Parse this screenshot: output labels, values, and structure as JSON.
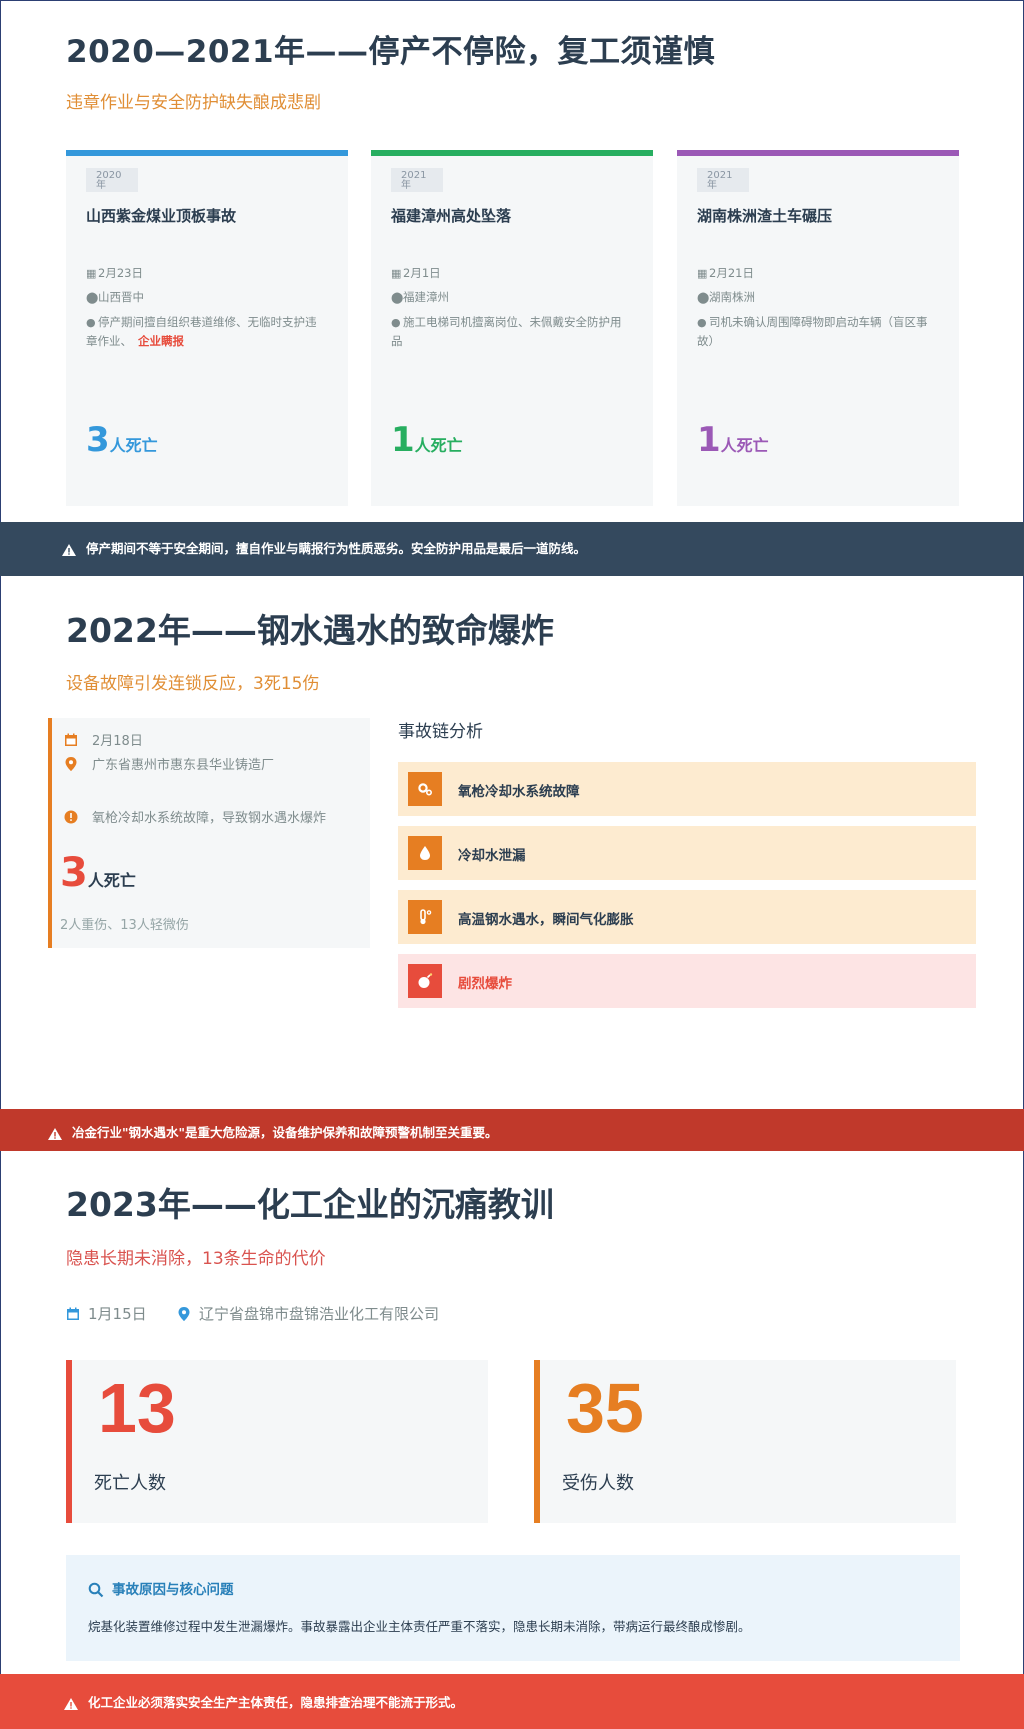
{
  "section1": {
    "title": "2020—2021年——停产不停险，复工须谨慎",
    "subtitle": "违章作业与安全防护缺失酿成悲剧",
    "cards": [
      {
        "color": "#3498db",
        "year": "2020",
        "year_suffix": "年",
        "title": "山西紫金煤业顶板事故",
        "date": "2月23日",
        "location": "山西晋中",
        "desc": "停产期间擅自组织巷道维修、无临时支护违章作业、",
        "desc_emphasis": "企业瞒报",
        "deaths": "3",
        "deaths_unit": "人死亡"
      },
      {
        "color": "#27ae60",
        "year": "2021",
        "year_suffix": "年",
        "title": "福建漳州高处坠落",
        "date": "2月1日",
        "location": "福建漳州",
        "desc": "施工电梯司机擅离岗位、未佩戴安全防护用品",
        "desc_emphasis": "",
        "deaths": "1",
        "deaths_unit": "人死亡"
      },
      {
        "color": "#9b59b6",
        "year": "2021",
        "year_suffix": "年",
        "title": "湖南株洲渣土车碾压",
        "date": "2月21日",
        "location": "湖南株洲",
        "desc": "司机未确认周围障碍物即启动车辆（盲区事故）",
        "desc_emphasis": "",
        "deaths": "1",
        "deaths_unit": "人死亡"
      }
    ],
    "banner": "停产期间不等于安全期间，擅自作业与瞒报行为性质恶劣。安全防护用品是最后一道防线。",
    "banner_color": "#34495e"
  },
  "section2": {
    "title": "2022年——钢水遇水的致命爆炸",
    "subtitle": "设备故障引发连锁反应，3死15伤",
    "date": "2月18日",
    "location": "广东省惠州市惠东县华业铸造厂",
    "cause": "氧枪冷却水系统故障，导致钢水遇水爆炸",
    "deaths": "3",
    "deaths_unit": "人死亡",
    "injuries": "2人重伤、13人轻微伤",
    "chain_title": "事故链分析",
    "chain": [
      {
        "icon": "gears-icon",
        "label": "氧枪冷却水系统故障"
      },
      {
        "icon": "water-drop-icon",
        "label": "冷却水泄漏"
      },
      {
        "icon": "thermometer-icon",
        "label": "高温钢水遇水，瞬间气化膨胀"
      },
      {
        "icon": "bomb-icon",
        "label": "剧烈爆炸"
      }
    ],
    "banner": "冶金行业\"钢水遇水\"是重大危险源，设备维护保养和故障预警机制至关重要。",
    "banner_color": "#c0392b"
  },
  "section3": {
    "title": "2023年——化工企业的沉痛教训",
    "subtitle": "隐患长期未消除，13条生命的代价",
    "date": "1月15日",
    "location": "辽宁省盘锦市盘锦浩业化工有限公司",
    "stats": [
      {
        "value": "13",
        "label": "死亡人数",
        "color": "#e74c3c"
      },
      {
        "value": "35",
        "label": "受伤人数",
        "color": "#e67e22"
      }
    ],
    "cause_heading": "事故原因与核心问题",
    "cause_text": "烷基化装置维修过程中发生泄漏爆炸。事故暴露出企业主体责任严重不落实，隐患长期未消除，带病运行最终酿成惨剧。",
    "banner": "化工企业必须落实安全生产主体责任，隐患排查治理不能流于形式。",
    "banner_color": "#e74c3c"
  }
}
